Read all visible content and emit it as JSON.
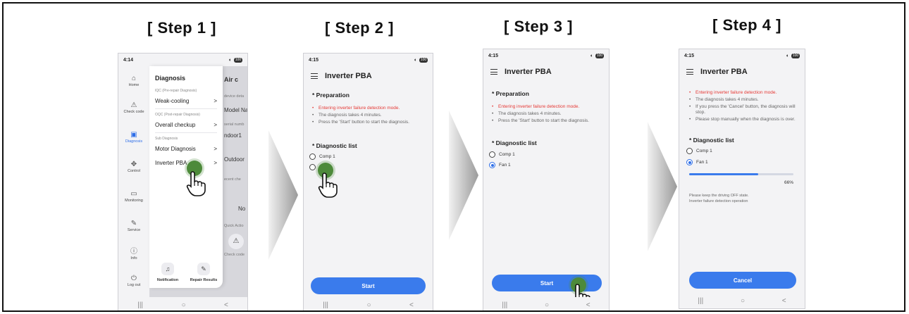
{
  "steps": [
    {
      "title": "[ Step 1 ]"
    },
    {
      "title": "[ Step 2 ]"
    },
    {
      "title": "[ Step 3 ]"
    },
    {
      "title": "[ Step 4 ]"
    }
  ],
  "status_times": [
    "4:14",
    "4:15",
    "4:15",
    "4:15"
  ],
  "status_battery": "100",
  "nav": {
    "recent": "|||",
    "home": "○",
    "back": "<"
  },
  "step1": {
    "sidebar": [
      {
        "label": "Home",
        "icon": "home-icon"
      },
      {
        "label": "Check code",
        "icon": "warning-icon"
      },
      {
        "label": "Diagnosis",
        "icon": "diagnosis-icon",
        "active": true
      },
      {
        "label": "Control",
        "icon": "control-icon"
      },
      {
        "label": "Monitoring",
        "icon": "monitor-icon"
      },
      {
        "label": "Service",
        "icon": "wrench-icon"
      },
      {
        "label": "Info",
        "icon": "info-icon"
      },
      {
        "label": "Log out",
        "icon": "power-icon"
      }
    ],
    "drawer": {
      "title": "Diagnosis",
      "iqc_label": "IQC (Pre-repair Diagnosis)",
      "weak_cooling": "Weak-cooling",
      "oqc_label": "OQC (Post-repair Diagnosis)",
      "overall_checkup": "Overall checkup",
      "sub_label": "Sub Diagnosis",
      "motor_diagnosis": "Motor Diagnosis",
      "inverter_pba": "Inverter PBA",
      "notification": "Notification",
      "repair_results": "Repair Results"
    },
    "behind": {
      "air": "Air c",
      "device": "device deta",
      "model": "Model Na",
      "serial": "serial numb",
      "indoor": "ndoor1",
      "outdoor": "Outdoor",
      "recent": "ecent che",
      "nop": "No p",
      "quick": "Quick Actio",
      "check_code": "Check code"
    }
  },
  "inverter": {
    "title": "Inverter PBA",
    "preparation": "* Preparation",
    "bullet_red": "Entering inverter failure detection mode.",
    "bullet_time": "The diagnosis takes 4 minutes.",
    "bullet_start": "Press the 'Start' button to start the diagnosis.",
    "bullet_cancel": "If you press the 'Cancel' button, the diagnosis will stop.",
    "bullet_stop": "Please stop manually when the diagnosis is over.",
    "diag_list": "* Diagnostic list",
    "comp": "Comp 1",
    "fan": "Fan 1",
    "start": "Start",
    "cancel": "Cancel",
    "progress": 0.66,
    "progress_label": "66%",
    "note1": "Please keep the driving OFF state.",
    "note2": "Inverter failure detection operation"
  },
  "colors": {
    "accent": "#3a7bec",
    "warning": "#e53935",
    "touch": "#4d8a3a"
  }
}
